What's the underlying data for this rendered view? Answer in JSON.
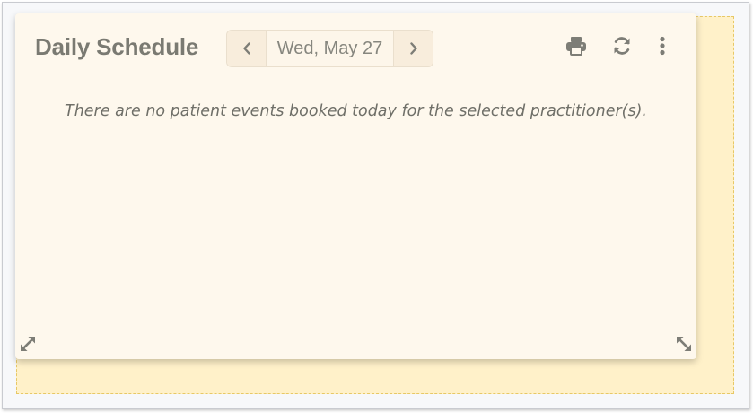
{
  "widget": {
    "title": "Daily Schedule",
    "date": "Wed, May 27",
    "empty_message": "There are no patient events booked today for the selected practitioner(s).",
    "icons": {
      "prev": "chevron-left-icon",
      "next": "chevron-right-icon",
      "print": "print-icon",
      "refresh": "refresh-icon",
      "more": "more-vertical-icon",
      "resize_left": "resize-diagonal-icon",
      "resize_right": "resize-diagonal-icon"
    }
  },
  "colors": {
    "card_bg": "#fef8ed",
    "drop_zone_bg": "#fff1c9",
    "drop_zone_border": "#e7c866",
    "text": "#7a7a72",
    "icon": "#7d7d76"
  }
}
